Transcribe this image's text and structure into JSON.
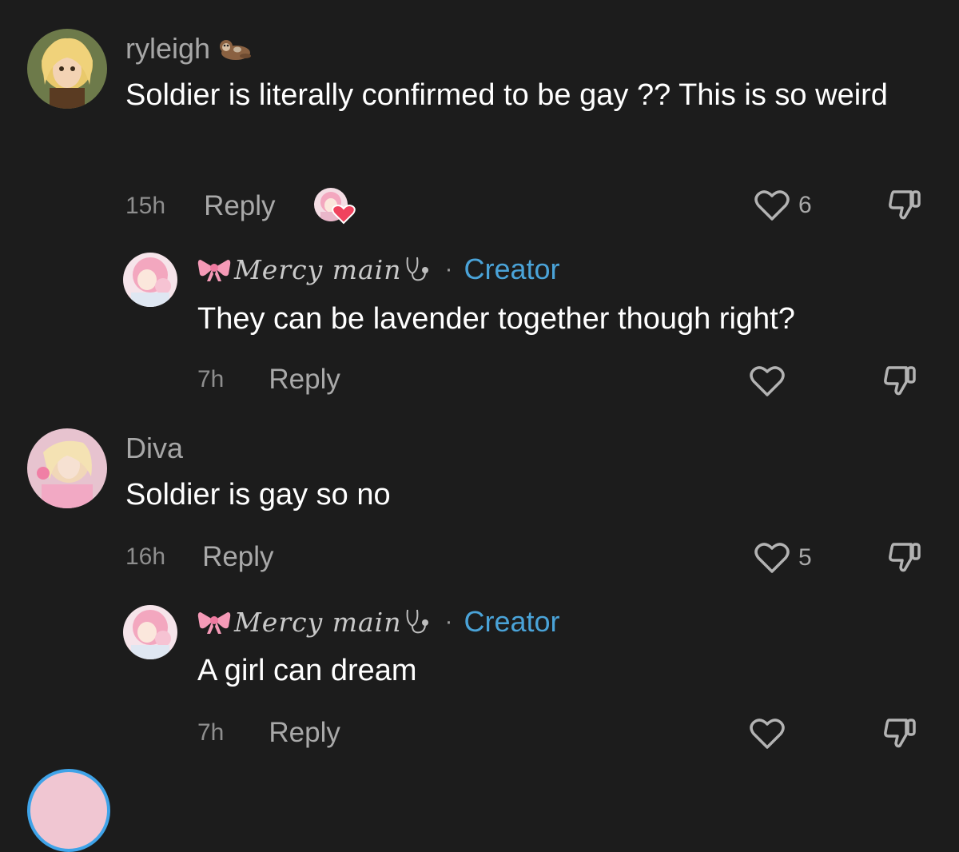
{
  "comments": [
    {
      "username": "ryleigh",
      "username_emoji": "otter-emoji",
      "text": "Soldier is literally confirmed to be gay ?? This is so weird",
      "time": "15h",
      "reply_label": "Reply",
      "likes": "6",
      "creator_liked": true,
      "replies": [
        {
          "name": "Mercy main",
          "name_decoration_left": "pink-bow-emoji",
          "name_decoration_right": "stethoscope-emoji",
          "separator": "·",
          "badge": "Creator",
          "text": "They can be lavender together though right?",
          "time": "7h",
          "reply_label": "Reply",
          "likes": ""
        }
      ]
    },
    {
      "username": "Diva",
      "text": "Soldier is gay so no",
      "time": "16h",
      "reply_label": "Reply",
      "likes": "5",
      "replies": [
        {
          "name": "Mercy main",
          "name_decoration_left": "pink-bow-emoji",
          "name_decoration_right": "stethoscope-emoji",
          "separator": "·",
          "badge": "Creator",
          "text": "A girl can dream",
          "time": "7h",
          "reply_label": "Reply",
          "likes": ""
        }
      ]
    }
  ],
  "colors": {
    "background": "#1c1c1c",
    "primary_text": "#ffffff",
    "secondary_text": "#a7a7a7",
    "creator_badge": "#4aa3d8",
    "creator_heart": "#f0435e"
  }
}
